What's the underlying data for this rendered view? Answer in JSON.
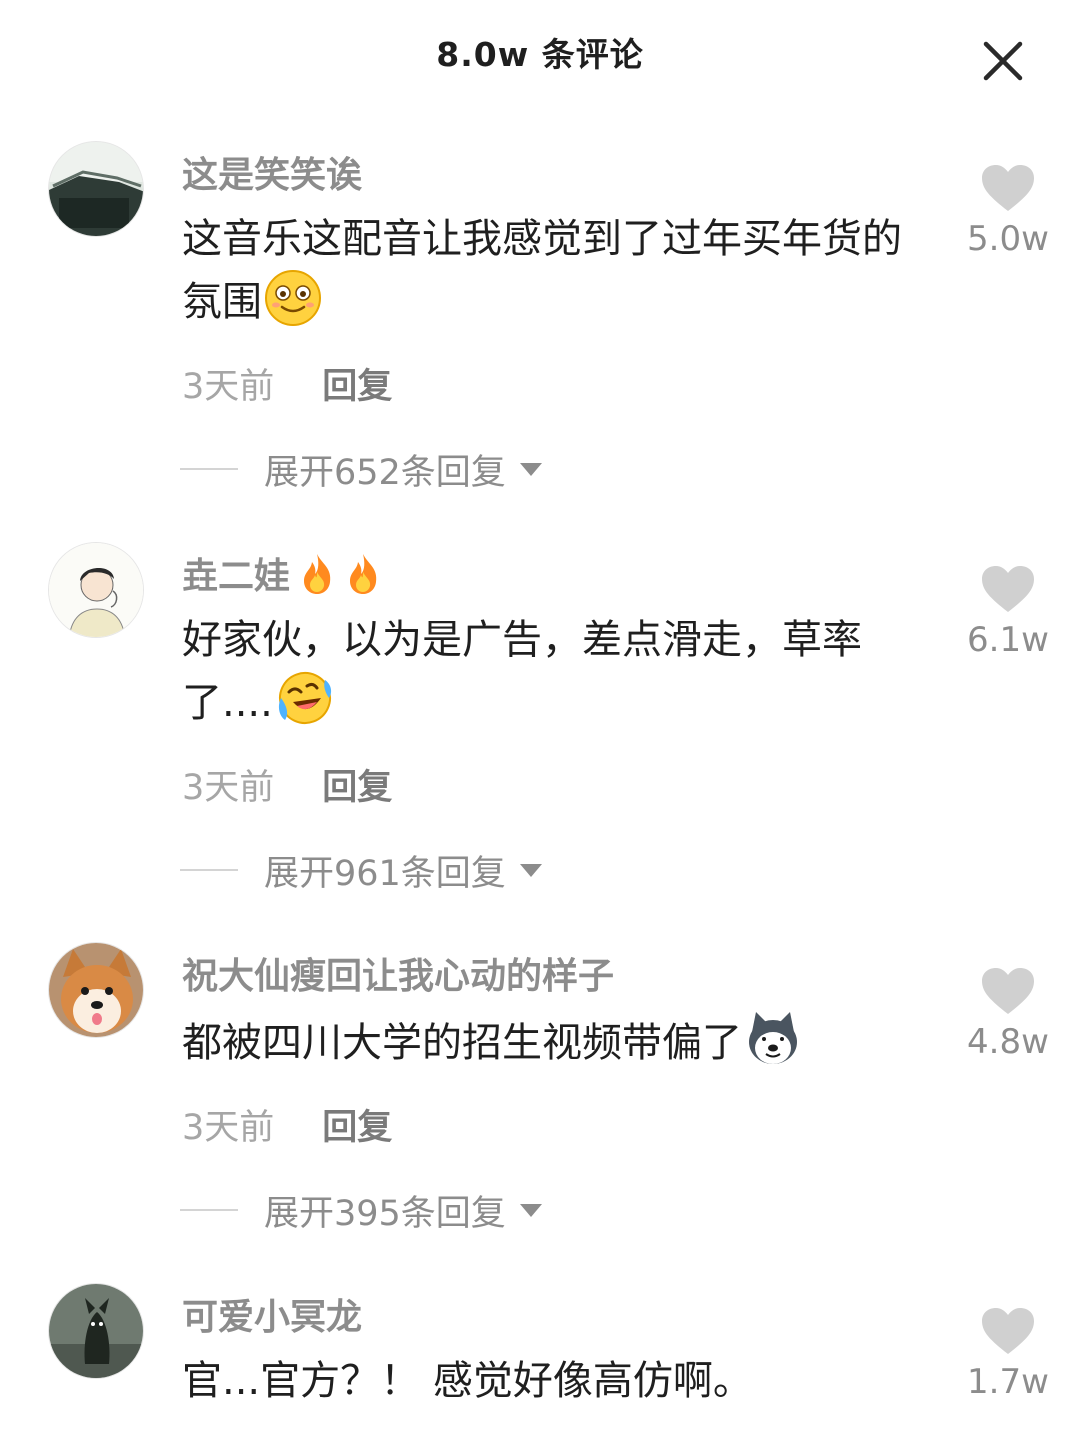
{
  "header": {
    "title": "8.0w 条评论",
    "close_icon": "close-icon"
  },
  "comments": [
    {
      "username": "这是笑笑诶",
      "text": "这音乐这配音让我感觉到了过年买年货的氛围",
      "emoji": "smiling-face-emoji",
      "time": "3天前",
      "reply_label": "回复",
      "expand_label": "展开652条回复",
      "likes": "5.0w"
    },
    {
      "username": "垚二娃",
      "username_badges": [
        "fire-icon",
        "fire-icon"
      ],
      "text": "好家伙，以为是广告，差点滑走，草率了....",
      "emoji": "laughing-crying-emoji",
      "time": "3天前",
      "reply_label": "回复",
      "expand_label": "展开961条回复",
      "likes": "6.1w"
    },
    {
      "username": "祝大仙瘦回让我心动的样子",
      "text": "都被四川大学的招生视频带偏了",
      "emoji": "husky-dog-emoji",
      "time": "3天前",
      "reply_label": "回复",
      "expand_label": "展开395条回复",
      "likes": "4.8w"
    },
    {
      "username": "可爱小冥龙",
      "text": "官...官方？！ 感觉好像高仿啊。",
      "likes": "1.7w"
    }
  ],
  "colors": {
    "username": "#8c8c8c",
    "text": "#1f1f1f",
    "meta": "#a6a6a6",
    "heart": "#d0d0d0"
  }
}
